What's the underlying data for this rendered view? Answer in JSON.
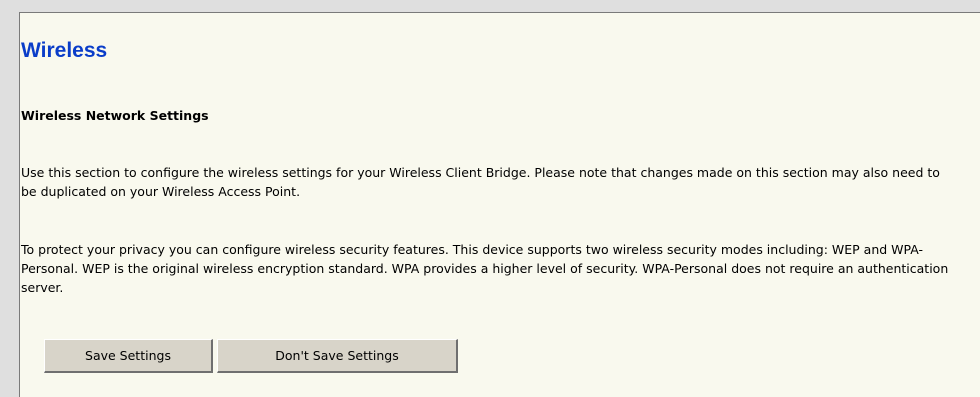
{
  "section": {
    "title": "Wireless",
    "subtitle": "Wireless Network Settings",
    "paragraph1": "Use this section to configure the wireless settings for your Wireless Client Bridge. Please note that changes made on this section may also need to be duplicated on your Wireless Access Point.",
    "paragraph2": "To protect your privacy you can configure wireless security features. This device supports two wireless security modes including: WEP and WPA-Personal. WEP is the original wireless encryption standard. WPA provides a higher level of security. WPA-Personal does not require an authentication server."
  },
  "buttons": {
    "save_label": "Save Settings",
    "dont_save_label": "Don't Save Settings"
  },
  "colors": {
    "title": "#0a3dc9",
    "panel_bg": "#f9f9ee",
    "outer_bg": "#dfdfdf",
    "button_bg": "#d8d4c9"
  }
}
